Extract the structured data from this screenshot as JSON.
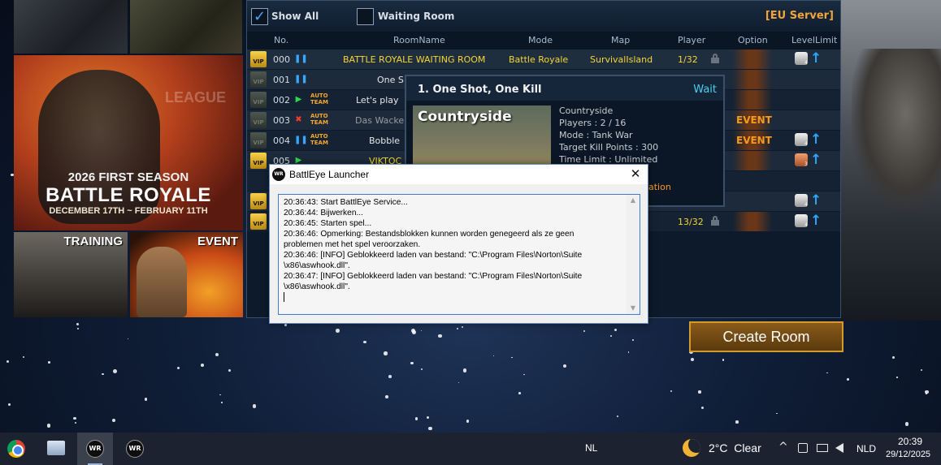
{
  "banners": {
    "season_line": "2026 FIRST SEASON",
    "title": "BATTLE ROYALE",
    "dates": "DECEMBER 17TH ~ FEBRUARY 11TH",
    "league_watermark": "LEAGUE",
    "training": "TRAINING",
    "event": "EVENT"
  },
  "filters": {
    "show_all": "Show All",
    "show_all_checked": "✓",
    "waiting_room": "Waiting Room",
    "server": "[EU Server]"
  },
  "columns": [
    "No.",
    "RoomName",
    "Mode",
    "Map",
    "Player",
    "Option",
    "LevelLimit"
  ],
  "vip_label": "VIP",
  "auto_team_label": "AUTO\nTEAM",
  "rooms": [
    {
      "no": "000",
      "name": "BATTLE ROYALE WAITING ROOM",
      "mode": "Battle Royale",
      "map": "SurvivalIsland",
      "player": "1/32",
      "vip": "gold",
      "state": "pause",
      "auto": false,
      "event": "",
      "rank": "silver",
      "rank_n": "4"
    },
    {
      "no": "001",
      "name": "One S",
      "mode": "",
      "map": "",
      "player": "",
      "vip": "dim",
      "state": "pause",
      "auto": false,
      "event": "",
      "rank": "",
      "rank_n": ""
    },
    {
      "no": "002",
      "name": "Let's play",
      "mode": "",
      "map": "",
      "player": "",
      "vip": "dim",
      "state": "play",
      "auto": true,
      "event": "",
      "rank": "",
      "rank_n": ""
    },
    {
      "no": "003",
      "name": "Das Wacke",
      "mode": "",
      "map": "",
      "player": "",
      "vip": "dim",
      "state": "stop",
      "auto": true,
      "event": "EVENT",
      "rank": "",
      "rank_n": ""
    },
    {
      "no": "004",
      "name": "Bobble",
      "mode": "",
      "map": "",
      "player": "",
      "vip": "dim",
      "state": "pause",
      "auto": true,
      "event": "EVENT",
      "rank": "silver",
      "rank_n": "4"
    },
    {
      "no": "005",
      "name": "VIKTOC",
      "mode": "",
      "map": "",
      "player": "",
      "vip": "gold",
      "state": "play",
      "auto": false,
      "event": "",
      "rank": "bronze",
      "rank_n": "3"
    },
    {
      "no": "",
      "name": "",
      "mode": "",
      "map": "",
      "player": "",
      "vip": "",
      "state": "",
      "auto": false,
      "event": "",
      "rank": "",
      "rank_n": ""
    },
    {
      "no": "",
      "name": "",
      "mode": "",
      "map": "",
      "player": "",
      "vip": "gold",
      "state": "",
      "auto": false,
      "event": "",
      "rank": "silver",
      "rank_n": "4"
    },
    {
      "no": "",
      "name": "",
      "mode": "",
      "map": "",
      "player": "13/32",
      "vip": "gold",
      "state": "",
      "auto": false,
      "event": "",
      "rank": "silver",
      "rank_n": "4"
    }
  ],
  "room_tip": {
    "title": "1. One Shot, One Kill",
    "status": "Wait",
    "map_name": "Countryside",
    "info": [
      "Countryside",
      "Players : 2 / 16",
      "Mode : Tank War",
      "Target Kill Points : 300",
      "Time Limit : Unlimited"
    ],
    "partial_text": "ation"
  },
  "dialog": {
    "app_icon": "WR",
    "title": "BattlEye Launcher",
    "close": "✕",
    "log": "20:36:43: Start BattlEye Service...\n20:36:44: Bijwerken...\n20:36:45: Starten spel...\n20:36:46: Opmerking: Bestandsblokken kunnen worden genegeerd als ze geen\nproblemen met het spel veroorzaken.\n20:36:46: [INFO] Geblokkeerd laden van bestand: \"C:\\Program Files\\Norton\\Suite\n\\x86\\aswhook.dll\".\n20:36:47: [INFO] Geblokkeerd laden van bestand: \"C:\\Program Files\\Norton\\Suite\n\\x86\\aswhook.dll\".",
    "scroll_up": "▲",
    "scroll_down": "▼"
  },
  "create_room": "Create Room",
  "taskbar": {
    "wr_label": "WR",
    "lang_left": "NL",
    "weather": "2°C  Clear",
    "tray_chevron": "^",
    "lang_right": "NLD",
    "time": "20:39",
    "date": "29/12/2025"
  }
}
